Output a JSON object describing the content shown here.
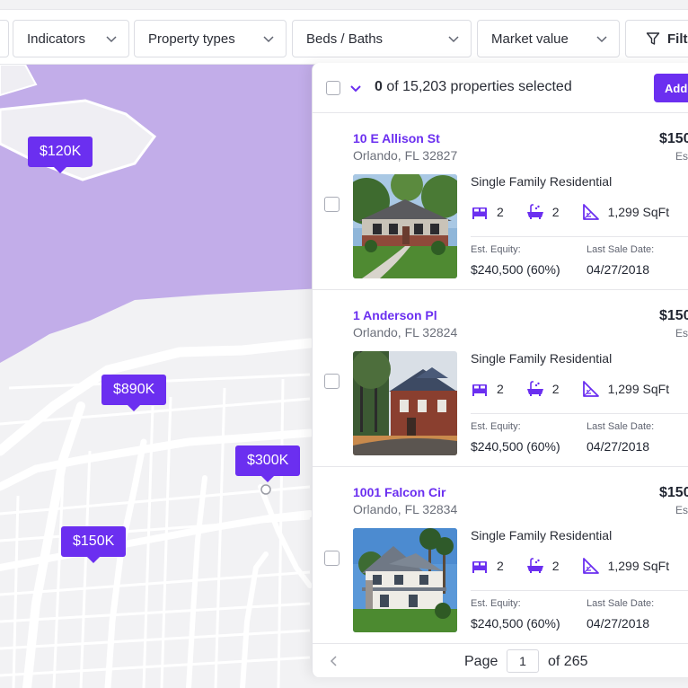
{
  "filters": [
    {
      "label": "Indicators"
    },
    {
      "label": "Property types"
    },
    {
      "label": "Beds / Baths"
    },
    {
      "label": "Market value"
    }
  ],
  "more_filters_label": "Filte",
  "map": {
    "price_pins": [
      "$120K",
      "$890K",
      "$300K",
      "$150K"
    ]
  },
  "panel": {
    "selected_count": "0",
    "selected_suffix": "of 15,203 properties selected",
    "add_button_label": "Add t"
  },
  "listings": [
    {
      "street": "10 E Allison St",
      "city": "Orlando, FL 32827",
      "price": "$150",
      "price_sub": "Est",
      "property_type": "Single Family Residential",
      "beds": "2",
      "baths": "2",
      "sqft": "1,299 SqFt",
      "equity_label": "Est. Equity:",
      "equity_value": "$240,500 (60%)",
      "sale_label": "Last Sale Date:",
      "sale_value": "04/27/2018"
    },
    {
      "street": "1 Anderson Pl",
      "city": "Orlando, FL 32824",
      "price": "$150",
      "price_sub": "Est",
      "property_type": "Single Family Residential",
      "beds": "2",
      "baths": "2",
      "sqft": "1,299 SqFt",
      "equity_label": "Est. Equity:",
      "equity_value": "$240,500 (60%)",
      "sale_label": "Last Sale Date:",
      "sale_value": "04/27/2018"
    },
    {
      "street": "1001 Falcon Cir",
      "city": "Orlando, FL 32834",
      "price": "$150",
      "price_sub": "Est",
      "property_type": "Single Family Residential",
      "beds": "2",
      "baths": "2",
      "sqft": "1,299 SqFt",
      "equity_label": "Est. Equity:",
      "equity_value": "$240,500 (60%)",
      "sale_label": "Last Sale Date:",
      "sale_value": "04/27/2018"
    }
  ],
  "pagination": {
    "page_label": "Page",
    "current_page": "1",
    "of_label": "of 265"
  },
  "colors": {
    "accent": "#6b2ff0",
    "water": "#c2ade9",
    "map_land": "#f2f2f4"
  }
}
